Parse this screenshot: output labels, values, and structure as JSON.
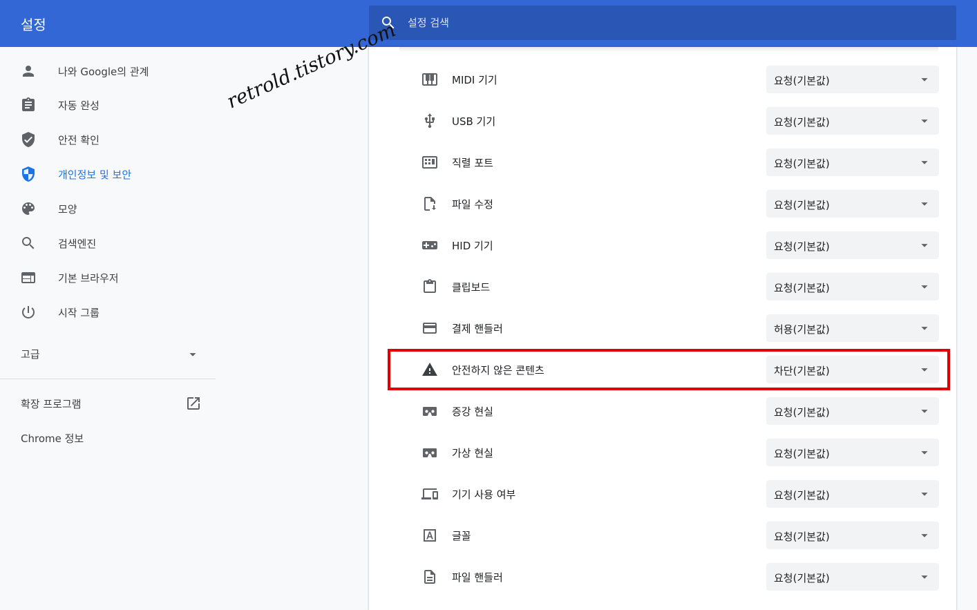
{
  "header": {
    "title": "설정",
    "search": {
      "placeholder": "설정 검색",
      "icon": "search-icon"
    }
  },
  "sidebar": {
    "items": [
      {
        "label": "나와 Google의 관계",
        "icon": "person-icon",
        "active": false
      },
      {
        "label": "자동 완성",
        "icon": "clipboard-icon",
        "active": false
      },
      {
        "label": "안전 확인",
        "icon": "shield-check-icon",
        "active": false
      },
      {
        "label": "개인정보 및 보안",
        "icon": "shield-privacy-icon",
        "active": true
      },
      {
        "label": "모양",
        "icon": "palette-icon",
        "active": false
      },
      {
        "label": "검색엔진",
        "icon": "search-icon",
        "active": false
      },
      {
        "label": "기본 브라우저",
        "icon": "browser-icon",
        "active": false
      },
      {
        "label": "시작 그룹",
        "icon": "power-icon",
        "active": false
      }
    ],
    "advanced_label": "고급",
    "extensions_label": "확장 프로그램",
    "about_label": "Chrome 정보"
  },
  "watermark": "retrold.tistory.com",
  "settings": {
    "rows": [
      {
        "label": "MIDI 기기",
        "value": "요청(기본값)",
        "icon": "piano-icon"
      },
      {
        "label": "USB 기기",
        "value": "요청(기본값)",
        "icon": "usb-icon"
      },
      {
        "label": "직렬 포트",
        "value": "요청(기본값)",
        "icon": "serial-port-icon"
      },
      {
        "label": "파일 수정",
        "value": "요청(기본값)",
        "icon": "file-edit-icon"
      },
      {
        "label": "HID 기기",
        "value": "요청(기본값)",
        "icon": "gamepad-icon"
      },
      {
        "label": "클립보드",
        "value": "요청(기본값)",
        "icon": "clipboard-icon"
      },
      {
        "label": "결제 핸들러",
        "value": "허용(기본값)",
        "icon": "credit-card-icon"
      },
      {
        "label": "안전하지 않은 콘텐츠",
        "value": "차단(기본값)",
        "icon": "warning-icon",
        "highlighted": true
      },
      {
        "label": "증강 현실",
        "value": "요청(기본값)",
        "icon": "vr-headset-icon"
      },
      {
        "label": "가상 현실",
        "value": "요청(기본값)",
        "icon": "vr-headset-icon"
      },
      {
        "label": "기기 사용 여부",
        "value": "요청(기본값)",
        "icon": "devices-icon"
      },
      {
        "label": "글꼴",
        "value": "요청(기본값)",
        "icon": "font-icon"
      },
      {
        "label": "파일 핸들러",
        "value": "요청(기본값)",
        "icon": "document-icon"
      }
    ]
  },
  "colors": {
    "header": "#3367d6",
    "search_bg": "#2a56b5",
    "active": "#1a73e8",
    "highlight_border": "#e00000",
    "select_bg": "#f1f3f4"
  }
}
